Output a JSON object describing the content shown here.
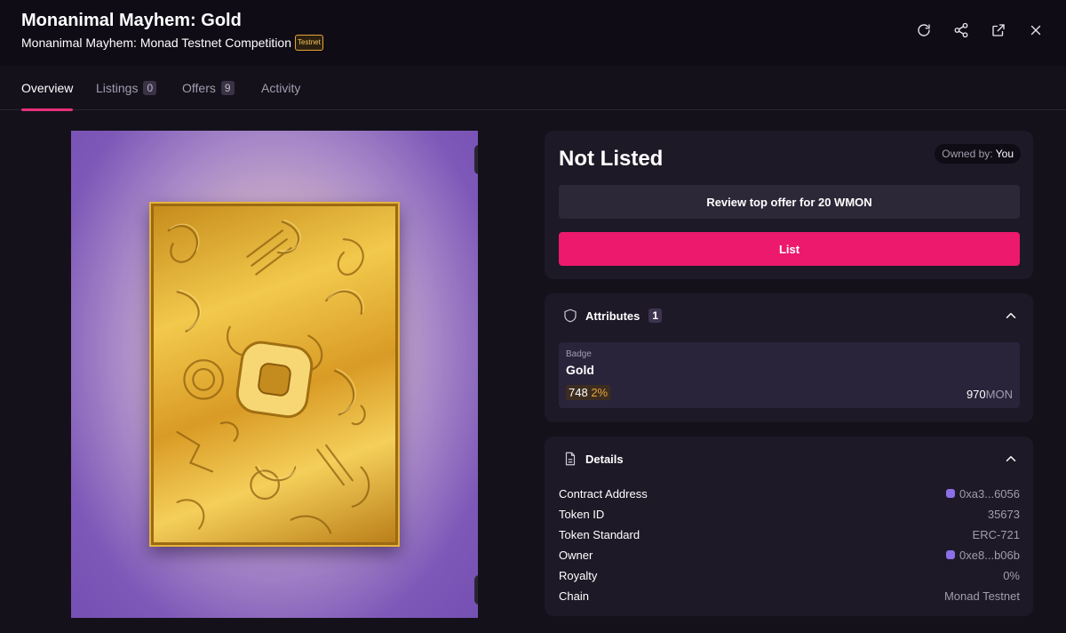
{
  "header": {
    "title": "Monanimal Mayhem: Gold",
    "collection": "Monanimal Mayhem: Monad Testnet Competition",
    "network_badge": "Testnet"
  },
  "header_actions": [
    "refresh-icon",
    "share-icon",
    "external-link-icon",
    "close-icon"
  ],
  "tabs": [
    {
      "label": "Overview",
      "active": true
    },
    {
      "label": "Listings",
      "count": "0"
    },
    {
      "label": "Offers",
      "count": "9"
    },
    {
      "label": "Activity"
    }
  ],
  "media": {
    "image_buttons": [
      "fullscreen-icon",
      "open-external-icon"
    ]
  },
  "status": {
    "title": "Not Listed",
    "owned_by_label": "Owned by:",
    "owner": "You",
    "review_offer_label": "Review top offer for 20 WMON",
    "list_label": "List"
  },
  "attributes": {
    "heading": "Attributes",
    "count": "1",
    "items": [
      {
        "type": "Badge",
        "value": "Gold",
        "count": "748",
        "percent": "2%",
        "floor": "970",
        "unit": "MON"
      }
    ]
  },
  "details": {
    "heading": "Details",
    "rows": [
      {
        "key": "Contract Address",
        "value": "0xa3...6056",
        "link": true
      },
      {
        "key": "Token ID",
        "value": "35673"
      },
      {
        "key": "Token Standard",
        "value": "ERC-721"
      },
      {
        "key": "Owner",
        "value": "0xe8...b06b",
        "link": true
      },
      {
        "key": "Royalty",
        "value": "0%"
      },
      {
        "key": "Chain",
        "value": "Monad Testnet"
      }
    ]
  },
  "colors": {
    "accent": "#ec196d",
    "background": "#14111b",
    "panel": "#1d1926",
    "badge_gold": "#e6a43a"
  }
}
